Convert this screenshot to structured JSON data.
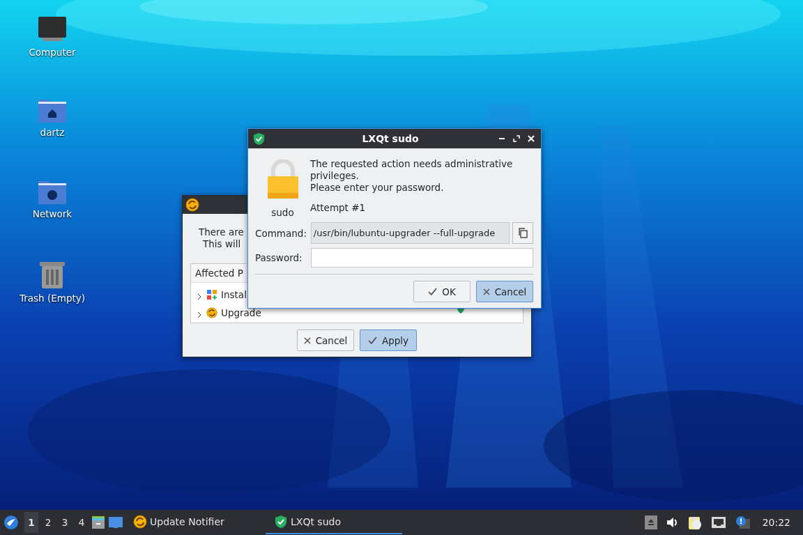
{
  "desktop_icons": [
    {
      "label": "Computer",
      "kind": "computer"
    },
    {
      "label": "dartz",
      "kind": "home"
    },
    {
      "label": "Network",
      "kind": "network"
    },
    {
      "label": "Trash (Empty)",
      "kind": "trash"
    }
  ],
  "updater_window": {
    "message_lines": [
      "There are",
      "This will"
    ],
    "tree": {
      "header": "Affected P",
      "items": [
        {
          "label": "Instal",
          "kind": "install",
          "expanded": false
        },
        {
          "label": "Upgrade",
          "kind": "upgrade",
          "expanded": false
        }
      ]
    },
    "buttons": [
      {
        "label": "Cancel",
        "kind": "cancel",
        "default": false
      },
      {
        "label": "Apply",
        "kind": "ok",
        "default": true
      }
    ]
  },
  "sudo_dialog": {
    "title": "LXQt sudo",
    "message_lines": [
      "The requested action needs administrative privileges.",
      "Please enter your password."
    ],
    "app_label": "sudo",
    "attempt": "Attempt #1",
    "command_label": "Command:",
    "command_value": "/usr/bin/lubuntu-upgrader --full-upgrade",
    "password_label": "Password:",
    "buttons": [
      {
        "label": "OK",
        "kind": "ok",
        "default": false
      },
      {
        "label": "Cancel",
        "kind": "cancel",
        "default": true
      }
    ]
  },
  "taskbar": {
    "workspaces": [
      {
        "label": "1",
        "selected": true
      },
      {
        "label": "2",
        "selected": false
      },
      {
        "label": "3",
        "selected": false
      },
      {
        "label": "4",
        "selected": false
      }
    ],
    "tasks": [
      {
        "label": "Update Notifier",
        "kind": "updater",
        "selected": false
      },
      {
        "label": "LXQt sudo",
        "kind": "shield",
        "selected": true
      }
    ],
    "clock": "20:22"
  }
}
